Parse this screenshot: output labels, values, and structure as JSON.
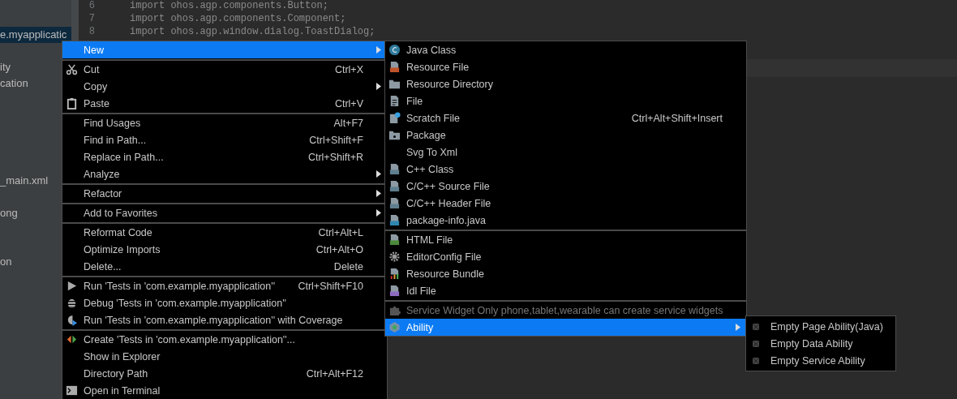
{
  "project_tree": {
    "items": [
      {
        "label": "e.myapplicatic",
        "selected": true
      },
      {
        "label": "ity",
        "selected": false
      },
      {
        "label": "cation",
        "selected": false
      },
      {
        "label": "_main.xml",
        "selected": false
      },
      {
        "label": "ong",
        "selected": false
      },
      {
        "label": "on",
        "selected": false
      }
    ]
  },
  "editor": {
    "lines": [
      {
        "number": "6",
        "code": "import ohos.agp.components.Button;"
      },
      {
        "number": "7",
        "code": "import ohos.agp.components.Component;"
      },
      {
        "number": "8",
        "code": "import ohos.agp.window.dialog.ToastDialog;"
      }
    ]
  },
  "context_menu": {
    "groups": [
      [
        {
          "label": "New",
          "has_submenu": true,
          "selected": true
        }
      ],
      [
        {
          "label": "Cut",
          "shortcut": "Ctrl+X",
          "has_submenu": false,
          "selected": false
        },
        {
          "label": "Copy",
          "has_submenu": true,
          "selected": false
        },
        {
          "label": "Paste",
          "shortcut": "Ctrl+V",
          "has_submenu": false,
          "selected": false
        }
      ],
      [
        {
          "label": "Find Usages",
          "shortcut": "Alt+F7",
          "has_submenu": false,
          "selected": false
        },
        {
          "label": "Find in Path...",
          "shortcut": "Ctrl+Shift+F",
          "has_submenu": false,
          "selected": false
        },
        {
          "label": "Replace in Path...",
          "shortcut": "Ctrl+Shift+R",
          "has_submenu": false,
          "selected": false
        },
        {
          "label": "Analyze",
          "has_submenu": true,
          "selected": false
        }
      ],
      [
        {
          "label": "Refactor",
          "has_submenu": true,
          "selected": false
        }
      ],
      [
        {
          "label": "Add to Favorites",
          "has_submenu": true,
          "selected": false
        }
      ],
      [
        {
          "label": "Reformat Code",
          "shortcut": "Ctrl+Alt+L",
          "has_submenu": false,
          "selected": false
        },
        {
          "label": "Optimize Imports",
          "shortcut": "Ctrl+Alt+O",
          "has_submenu": false,
          "selected": false
        },
        {
          "label": "Delete...",
          "shortcut": "Delete",
          "has_submenu": false,
          "selected": false
        }
      ],
      [
        {
          "label": "Run 'Tests in 'com.example.myapplication''",
          "shortcut": "Ctrl+Shift+F10",
          "has_submenu": false,
          "selected": false
        },
        {
          "label": "Debug 'Tests in 'com.example.myapplication''",
          "has_submenu": false,
          "selected": false
        },
        {
          "label": "Run 'Tests in 'com.example.myapplication'' with Coverage",
          "has_submenu": false,
          "selected": false
        }
      ],
      [
        {
          "label": "Create 'Tests in 'com.example.myapplication''...",
          "has_submenu": false,
          "selected": false
        },
        {
          "label": "Show in Explorer",
          "has_submenu": false,
          "selected": false
        },
        {
          "label": "Directory Path",
          "shortcut": "Ctrl+Alt+F12",
          "has_submenu": false,
          "selected": false
        },
        {
          "label": "Open in Terminal",
          "has_submenu": false,
          "selected": false
        }
      ]
    ]
  },
  "new_submenu": {
    "groups": [
      [
        {
          "label": "Java Class",
          "has_submenu": false,
          "selected": false,
          "disabled": false
        },
        {
          "label": "Resource File",
          "has_submenu": false,
          "selected": false,
          "disabled": false
        },
        {
          "label": "Resource Directory",
          "has_submenu": false,
          "selected": false,
          "disabled": false
        },
        {
          "label": "File",
          "has_submenu": false,
          "selected": false,
          "disabled": false
        },
        {
          "label": "Scratch File",
          "shortcut": "Ctrl+Alt+Shift+Insert",
          "has_submenu": false,
          "selected": false,
          "disabled": false
        },
        {
          "label": "Package",
          "has_submenu": false,
          "selected": false,
          "disabled": false
        },
        {
          "label": "Svg To Xml",
          "has_submenu": false,
          "selected": false,
          "disabled": false
        },
        {
          "label": "C++ Class",
          "has_submenu": false,
          "selected": false,
          "disabled": false
        },
        {
          "label": "C/C++ Source File",
          "has_submenu": false,
          "selected": false,
          "disabled": false
        },
        {
          "label": "C/C++ Header File",
          "has_submenu": false,
          "selected": false,
          "disabled": false
        },
        {
          "label": "package-info.java",
          "has_submenu": false,
          "selected": false,
          "disabled": false
        }
      ],
      [
        {
          "label": "HTML File",
          "has_submenu": false,
          "selected": false,
          "disabled": false
        },
        {
          "label": "EditorConfig File",
          "has_submenu": false,
          "selected": false,
          "disabled": false
        },
        {
          "label": "Resource Bundle",
          "has_submenu": false,
          "selected": false,
          "disabled": false
        },
        {
          "label": "Idl File",
          "has_submenu": false,
          "selected": false,
          "disabled": false
        }
      ],
      [
        {
          "label": "Service Widget Only phone,tablet,wearable can create service widgets",
          "has_submenu": false,
          "selected": false,
          "disabled": true
        },
        {
          "label": "Ability",
          "has_submenu": true,
          "selected": true,
          "disabled": false
        }
      ]
    ]
  },
  "ability_submenu": {
    "items": [
      {
        "label": "Empty Page Ability(Java)",
        "selected": false
      },
      {
        "label": "Empty Data Ability",
        "selected": false
      },
      {
        "label": "Empty Service Ability",
        "selected": false
      }
    ]
  }
}
